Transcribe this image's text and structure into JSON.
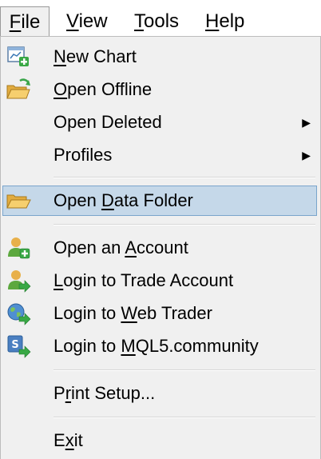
{
  "menubar": {
    "items": [
      {
        "pre": "",
        "key": "F",
        "post": "ile"
      },
      {
        "pre": "",
        "key": "V",
        "post": "iew"
      },
      {
        "pre": "",
        "key": "T",
        "post": "ools"
      },
      {
        "pre": "",
        "key": "H",
        "post": "elp"
      }
    ]
  },
  "file_menu": {
    "items": [
      {
        "pre": "",
        "key": "N",
        "post": "ew Chart",
        "icon": "new-chart-icon"
      },
      {
        "pre": "",
        "key": "O",
        "post": "pen Offline",
        "icon": "open-offline-icon"
      },
      {
        "pre": "Open Deleted",
        "key": "",
        "post": "",
        "submenu": true
      },
      {
        "pre": "Profiles",
        "key": "",
        "post": "",
        "submenu": true
      },
      {
        "pre": "Open ",
        "key": "D",
        "post": "ata Folder",
        "icon": "folder-icon",
        "highlighted": true
      },
      {
        "pre": "Open an ",
        "key": "A",
        "post": "ccount",
        "icon": "add-account-icon"
      },
      {
        "pre": "",
        "key": "L",
        "post": "ogin to Trade Account",
        "icon": "login-account-icon"
      },
      {
        "pre": "Login to ",
        "key": "W",
        "post": "eb Trader",
        "icon": "web-trader-icon"
      },
      {
        "pre": "Login to ",
        "key": "M",
        "post": "QL5.community",
        "icon": "mql5-community-icon"
      },
      {
        "pre": "P",
        "key": "r",
        "post": "int Setup...",
        "icon": ""
      },
      {
        "pre": "E",
        "key": "x",
        "post": "it",
        "icon": ""
      }
    ]
  },
  "colors": {
    "highlight_bg": "#c5d8e9",
    "highlight_border": "#7aa5cc",
    "menu_bg": "#f0f0f0"
  }
}
